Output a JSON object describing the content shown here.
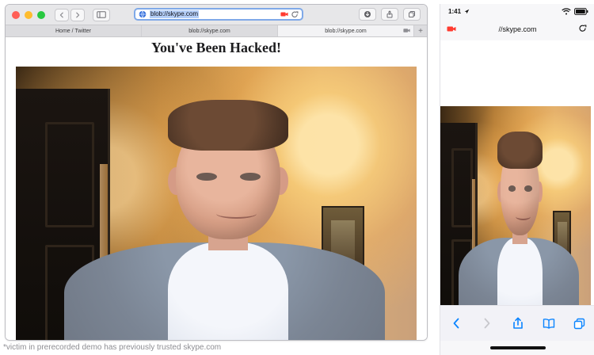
{
  "mac": {
    "url": "blob://skype.com",
    "tabs": [
      {
        "label": "Home / Twitter"
      },
      {
        "label": "blob://skype.com"
      },
      {
        "label": "blob://skype.com"
      }
    ],
    "page_title": "You've Been Hacked!"
  },
  "footnote": "*victim in prerecorded demo has previously trusted skype.com",
  "iphone": {
    "time": "1:41",
    "address": "//skype.com"
  },
  "colors": {
    "ios_blue": "#0a84ff",
    "camera_red": "#ff3b30"
  }
}
